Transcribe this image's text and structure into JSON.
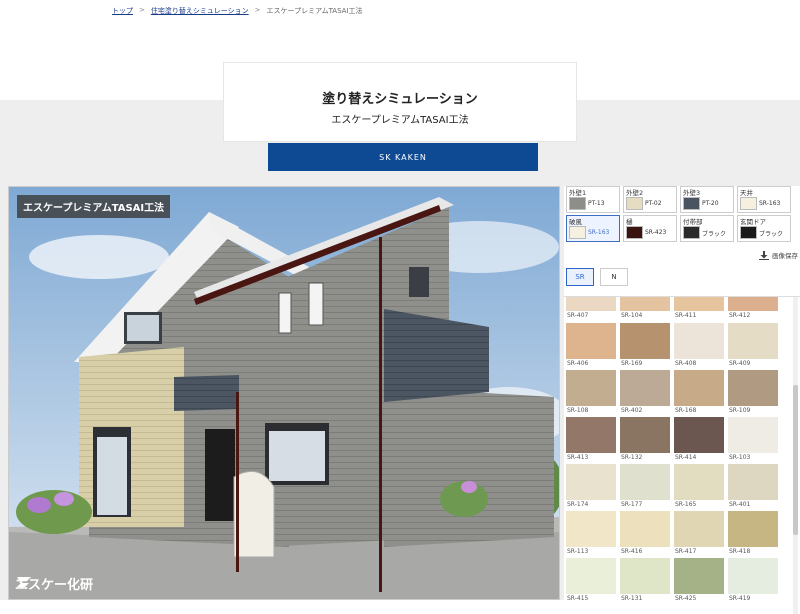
{
  "breadcrumb": {
    "home": "トップ",
    "sim": "住宅塗り替えシミュレーション",
    "current": "エスケープレミアムTASAI工法"
  },
  "title": {
    "main": "塗り替えシミュレーション",
    "sub": "エスケープレミアムTASAI工法"
  },
  "brand_button": "SK KAKEN",
  "image": {
    "method_tag": "エスケープレミアムTASAI工法",
    "logo": "エスケー化研"
  },
  "slots": [
    {
      "label": "外壁1",
      "code": "PT-13",
      "color": "#8e8e88"
    },
    {
      "label": "外壁2",
      "code": "PT-02",
      "color": "#e6dcc2"
    },
    {
      "label": "外壁3",
      "code": "PT-20",
      "color": "#4a5360"
    },
    {
      "label": "天井",
      "code": "SR-163",
      "color": "#f5f0df"
    },
    {
      "label": "破風",
      "code": "SR-163",
      "color": "#f5f0df"
    },
    {
      "label": "樋",
      "code": "SR-423",
      "color": "#3a1410"
    },
    {
      "label": "付帯部",
      "code": "ブラック",
      "color": "#2a2a2a"
    },
    {
      "label": "玄関ドア",
      "code": "ブラック",
      "color": "#1a1a1a"
    }
  ],
  "save_label": "画像保存",
  "tabs": [
    "SR",
    "N"
  ],
  "first_row": [
    {
      "code": "SR-407",
      "color": "#ead8c2"
    },
    {
      "code": "SR-104",
      "color": "#e3c3a0"
    },
    {
      "code": "SR-411",
      "color": "#e6c49e"
    },
    {
      "code": "SR-412",
      "color": "#dcb08e"
    }
  ],
  "palette": [
    {
      "code": "SR-406",
      "color": "#ddb48e"
    },
    {
      "code": "SR-169",
      "color": "#b7926e"
    },
    {
      "code": "SR-408",
      "color": "#ece4d8"
    },
    {
      "code": "SR-409",
      "color": "#e5dcc5"
    },
    {
      "code": "SR-108",
      "color": "#c3ad91"
    },
    {
      "code": "SR-402",
      "color": "#bcaa96"
    },
    {
      "code": "SR-168",
      "color": "#c7aa88"
    },
    {
      "code": "SR-109",
      "color": "#b09a82"
    },
    {
      "code": "SR-413",
      "color": "#93786a"
    },
    {
      "code": "SR-132",
      "color": "#8a7462"
    },
    {
      "code": "SR-414",
      "color": "#6b5650"
    },
    {
      "code": "SR-103",
      "color": "#efece6"
    },
    {
      "code": "SR-174",
      "color": "#e9e2cf"
    },
    {
      "code": "SR-177",
      "color": "#dfe0ce"
    },
    {
      "code": "SR-165",
      "color": "#e2dcc0"
    },
    {
      "code": "SR-401",
      "color": "#ddd6c1"
    },
    {
      "code": "SR-113",
      "color": "#f1e7c8"
    },
    {
      "code": "SR-416",
      "color": "#ece0bd"
    },
    {
      "code": "SR-417",
      "color": "#e1d6b4"
    },
    {
      "code": "SR-418",
      "color": "#c6b684"
    },
    {
      "code": "SR-415",
      "color": "#e9efd9"
    },
    {
      "code": "SR-131",
      "color": "#dfe6c8"
    },
    {
      "code": "SR-425",
      "color": "#a5b287"
    },
    {
      "code": "SR-419",
      "color": "#e5ede0"
    }
  ]
}
